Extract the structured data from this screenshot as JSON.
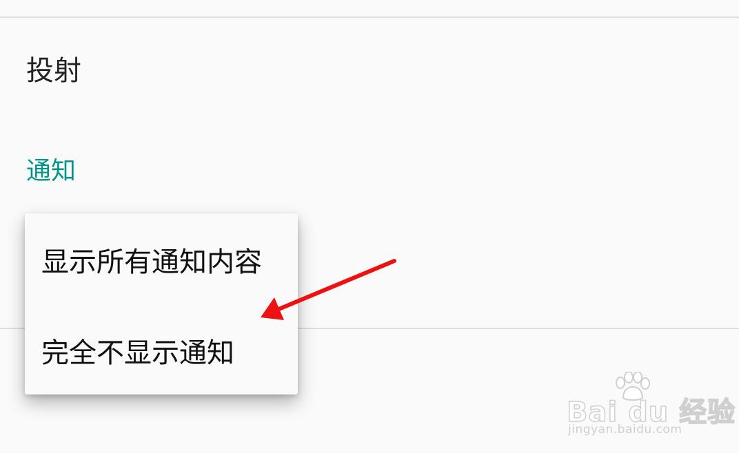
{
  "settings": {
    "cast_title": "投射",
    "notifications_header": "通知"
  },
  "popup_menu": {
    "items": [
      {
        "label": "显示所有通知内容"
      },
      {
        "label": "完全不显示通知"
      }
    ]
  },
  "annotation": {
    "arrow_color": "#ee1111"
  },
  "watermark": {
    "brand": "Bai du 经验",
    "url": "jingyan.baidu.com",
    "icon": "paw-icon"
  },
  "colors": {
    "accent": "#009688",
    "background": "#fafafa",
    "divider": "#dedede"
  }
}
